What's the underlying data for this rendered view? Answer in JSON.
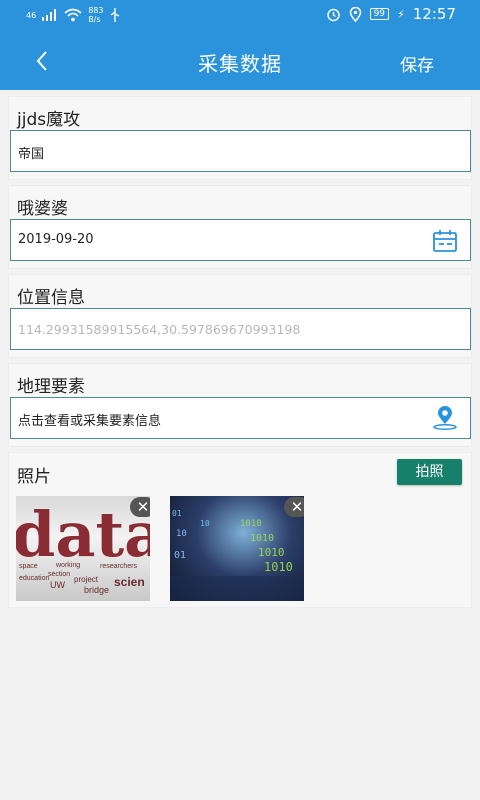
{
  "status": {
    "network": "46",
    "speed_value": "883",
    "speed_unit": "B/s",
    "battery": "99",
    "time": "12:57"
  },
  "appbar": {
    "title": "采集数据",
    "save_label": "保存"
  },
  "fields": [
    {
      "label": "jjds魔攻",
      "value": "帝国"
    },
    {
      "label": "哦婆婆",
      "value": "2019-09-20"
    },
    {
      "label": "位置信息",
      "placeholder": "114.29931589915564,30.597869670993198"
    },
    {
      "label": "地理要素",
      "placeholder": "点击查看或采集要素信息"
    }
  ],
  "photos": {
    "label": "照片",
    "button_label": "拍照",
    "close_glyph": "✕",
    "items": [
      {
        "words": [
          "data",
          "space",
          "working",
          "researchers",
          "section",
          "project",
          "education",
          "UW",
          "bridge",
          "scien"
        ]
      },
      {
        "words": [
          "01",
          "10",
          "1010"
        ]
      }
    ]
  },
  "colors": {
    "primary": "#2a93dc",
    "accent": "#17806b",
    "field_border": "#4a8a94"
  },
  "icons": {
    "back": "chevron-left-icon",
    "calendar": "calendar-icon",
    "location": "location-pin-icon"
  }
}
